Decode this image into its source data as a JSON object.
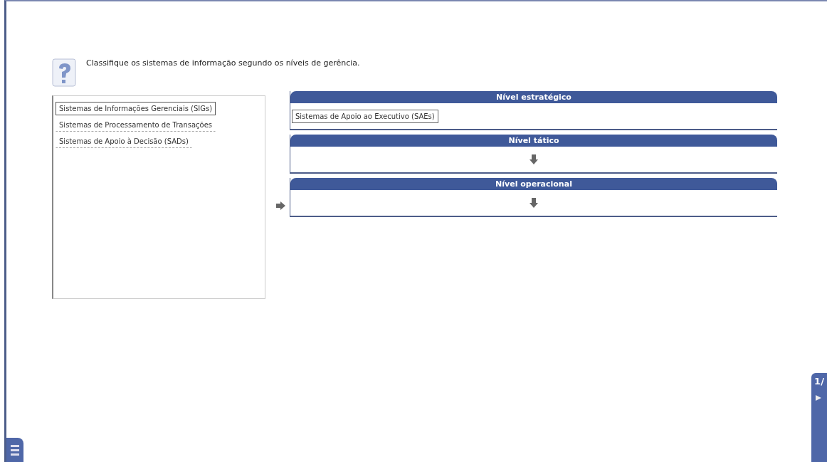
{
  "question": "Classifique os sistemas de informação segundo os níveis de gerência.",
  "options": [
    {
      "label": "Sistemas de Informações Gerenciais (SIGs)",
      "selected": true
    },
    {
      "label": "Sistemas de Processamento de Transações",
      "selected": false
    },
    {
      "label": "Sistemas de Apoio à Decisão (SADs)",
      "selected": false
    }
  ],
  "levels": [
    {
      "title": "Nível estratégico",
      "pointed": false,
      "items": [
        "Sistemas de Apoio ao Executivo (SAEs)"
      ]
    },
    {
      "title": "Nível tático",
      "pointed": false
    },
    {
      "title": "Nível operacional",
      "pointed": true
    }
  ],
  "page_counter": "1/"
}
